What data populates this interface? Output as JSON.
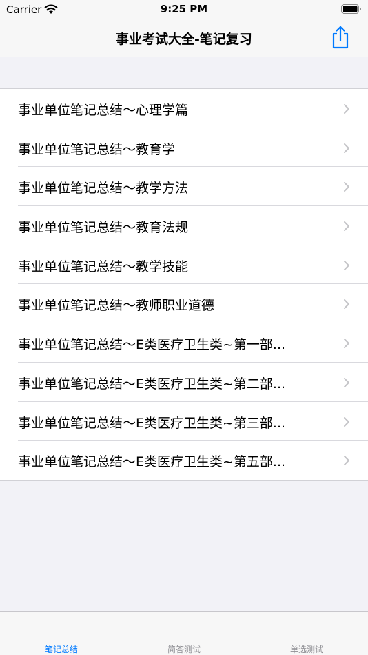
{
  "status_bar": {
    "carrier": "Carrier",
    "time": "9:25 PM"
  },
  "nav": {
    "title": "事业考试大全-笔记复习",
    "share_icon": "share-icon"
  },
  "list": {
    "items": [
      {
        "label": "事业单位笔记总结～心理学篇"
      },
      {
        "label": "事业单位笔记总结～教育学"
      },
      {
        "label": "事业单位笔记总结～教学方法"
      },
      {
        "label": "事业单位笔记总结～教育法规"
      },
      {
        "label": "事业单位笔记总结～教学技能"
      },
      {
        "label": "事业单位笔记总结～教师职业道德"
      },
      {
        "label": "事业单位笔记总结～E类医疗卫生类~第一部..."
      },
      {
        "label": "事业单位笔记总结～E类医疗卫生类~第二部..."
      },
      {
        "label": "事业单位笔记总结～E类医疗卫生类~第三部..."
      },
      {
        "label": "事业单位笔记总结～E类医疗卫生类~第五部..."
      }
    ]
  },
  "tabs": [
    {
      "label": "笔记总结",
      "active": true
    },
    {
      "label": "简答测试",
      "active": false
    },
    {
      "label": "单选测试",
      "active": false
    }
  ],
  "colors": {
    "accent": "#007aff",
    "inactive": "#8e8e93",
    "chevron": "#c4c4c7"
  }
}
